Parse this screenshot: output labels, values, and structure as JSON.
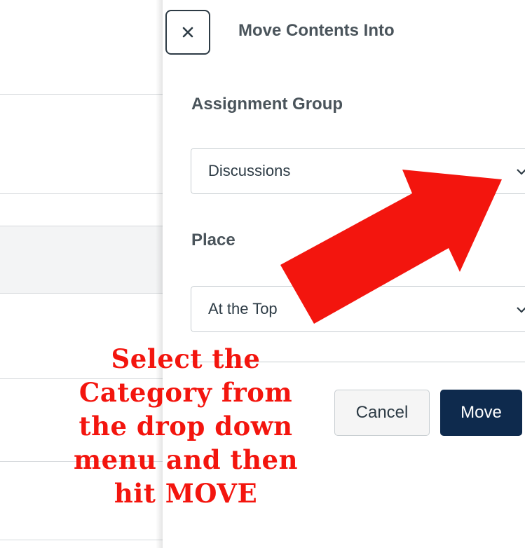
{
  "tray": {
    "title": "Move Contents Into",
    "close_icon": "close-icon"
  },
  "assignment_group": {
    "label": "Assignment Group",
    "selected": "Discussions"
  },
  "place": {
    "label": "Place",
    "selected": "At the Top"
  },
  "actions": {
    "cancel_label": "Cancel",
    "move_label": "Move"
  },
  "annotation": {
    "lines": [
      "Select the",
      "Category from",
      "the drop down",
      "menu and then",
      "hit MOVE"
    ],
    "arrow_icon": "red-arrow-icon"
  },
  "colors": {
    "primary_button": "#0e2a4d",
    "annotation_red": "#f3150e",
    "text_dark": "#2d3b45",
    "label_gray": "#4a545b"
  }
}
